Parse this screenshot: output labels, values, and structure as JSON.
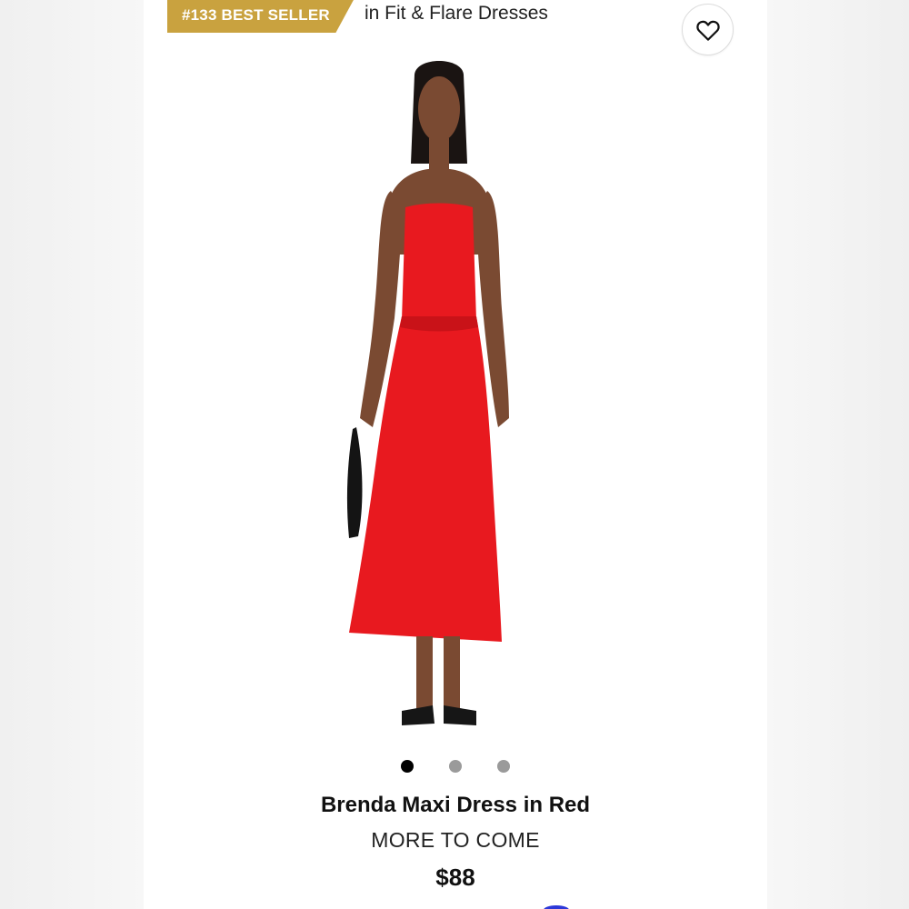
{
  "badge": {
    "text": "#133 BEST SELLER",
    "color": "#c9a23f"
  },
  "category": {
    "text": "in Fit & Flare Dresses"
  },
  "favorite": {
    "icon": "heart-outline-icon"
  },
  "product": {
    "name": "Brenda Maxi Dress in Red",
    "brand": "MORE TO COME",
    "price": "$88",
    "dress_color": "#e8191f"
  },
  "carousel": {
    "count": 3,
    "active_index": 0
  }
}
